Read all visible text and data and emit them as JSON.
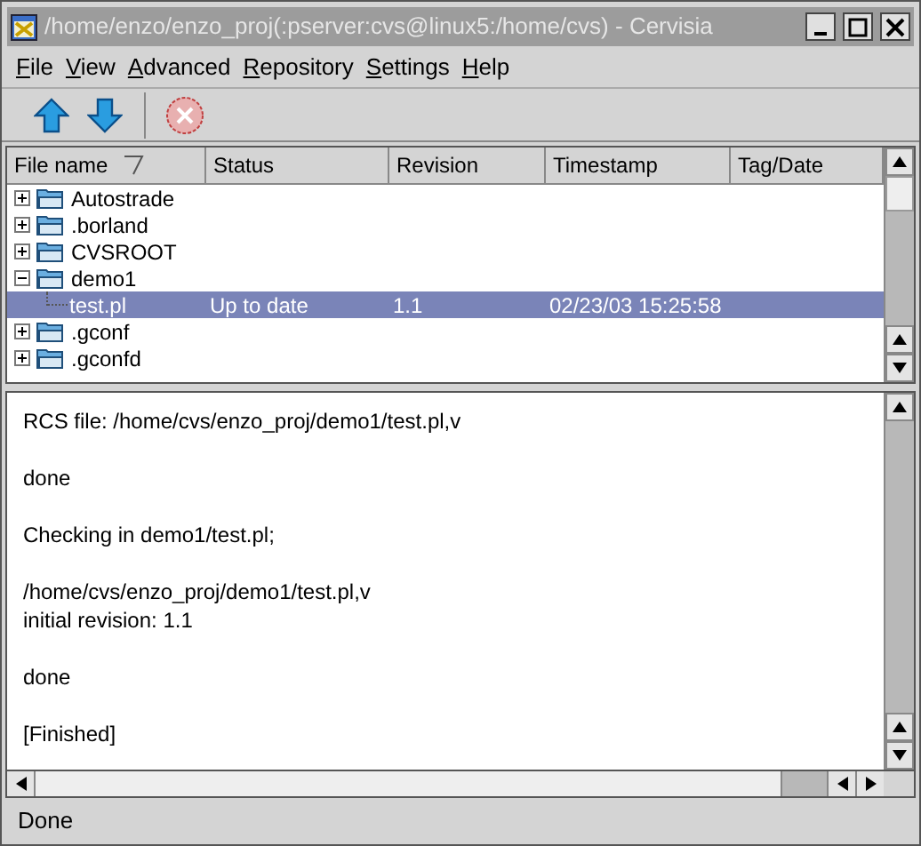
{
  "window": {
    "title": "/home/enzo/enzo_proj(:pserver:cvs@linux5:/home/cvs) - Cervisia"
  },
  "menu": [
    "File",
    "View",
    "Advanced",
    "Repository",
    "Settings",
    "Help"
  ],
  "table": {
    "columns": [
      {
        "label": "File name",
        "sorted": true
      },
      {
        "label": "Status",
        "sorted": false
      },
      {
        "label": "Revision",
        "sorted": false
      },
      {
        "label": "Timestamp",
        "sorted": false
      },
      {
        "label": "Tag/Date",
        "sorted": false
      }
    ],
    "rows": [
      {
        "name": "Autostrade",
        "kind": "folder",
        "expanded": false,
        "selected": false
      },
      {
        "name": ".borland",
        "kind": "folder",
        "expanded": false,
        "selected": false
      },
      {
        "name": "CVSROOT",
        "kind": "folder",
        "expanded": false,
        "selected": false
      },
      {
        "name": "demo1",
        "kind": "folder",
        "expanded": true,
        "selected": false,
        "children": [
          {
            "name": "test.pl",
            "kind": "file",
            "selected": true,
            "status": "Up to date",
            "revision": "1.1",
            "timestamp": "02/23/03 15:25:58"
          }
        ]
      },
      {
        "name": ".gconf",
        "kind": "folder",
        "expanded": false,
        "selected": false
      },
      {
        "name": ".gconfd",
        "kind": "folder",
        "expanded": false,
        "selected": false
      }
    ]
  },
  "log": [
    [
      "RCS file: /home/cvs/enzo_proj/demo1/test.pl,v"
    ],
    [
      "done"
    ],
    [
      "Checking in demo1/test.pl;"
    ],
    [
      "/home/cvs/enzo_proj/demo1/test.pl,v",
      "initial revision: 1.1"
    ],
    [
      "done"
    ],
    [
      "[Finished]"
    ]
  ],
  "status_bar": "Done"
}
